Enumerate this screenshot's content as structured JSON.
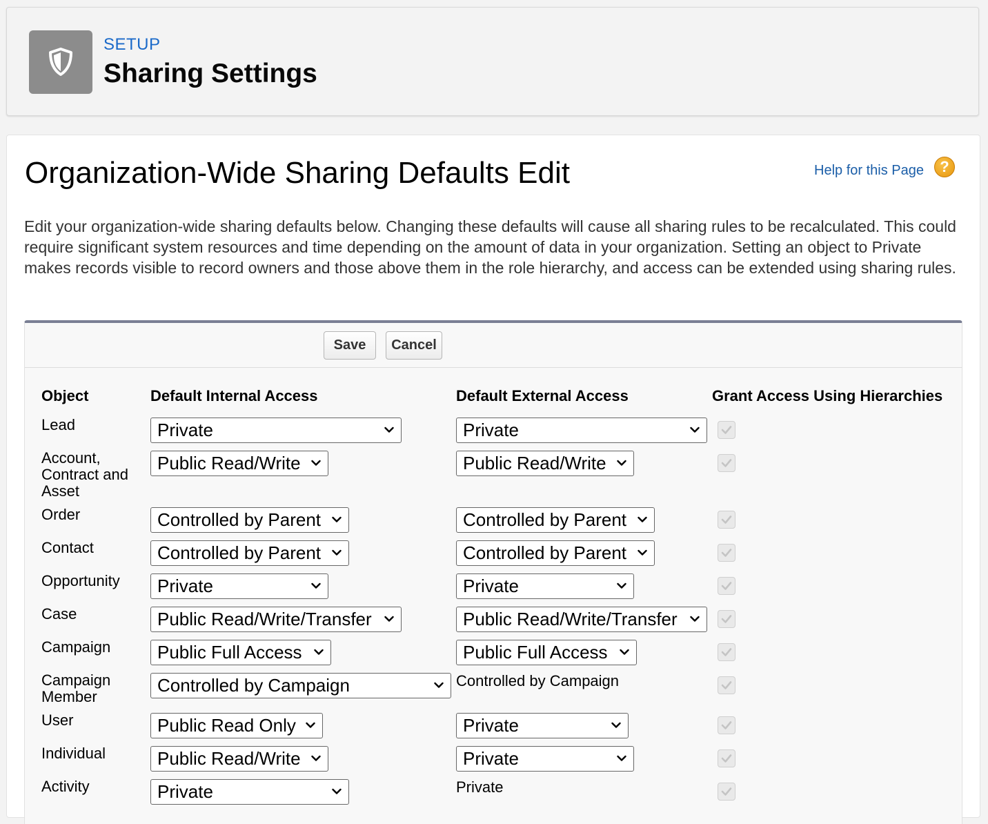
{
  "header": {
    "setup_label": "SETUP",
    "title": "Sharing Settings",
    "icon": "shield-icon"
  },
  "section": {
    "title": "Organization-Wide Sharing Defaults Edit",
    "help_link": "Help for this Page",
    "help_icon": "?",
    "description": "Edit your organization-wide sharing defaults below. Changing these defaults will cause all sharing rules to be recalculated. This could require significant system resources and time depending on the amount of data in your organization. Setting an object to Private makes records visible to record owners and those above them in the role hierarchy, and access can be extended using sharing rules."
  },
  "buttons": {
    "save": "Save",
    "cancel": "Cancel"
  },
  "columns": {
    "object": "Object",
    "internal": "Default Internal Access",
    "external": "Default External Access",
    "hierarchies": "Grant Access Using Hierarchies"
  },
  "rows": [
    {
      "object": "Lead",
      "internal": "Private",
      "external": "Private",
      "external_editable": true,
      "hierarchies": true
    },
    {
      "object": "Account,\nContract and\nAsset",
      "internal": "Public Read/Write",
      "external": "Public Read/Write",
      "external_editable": true,
      "hierarchies": true
    },
    {
      "object": "Order",
      "internal": "Controlled by Parent",
      "external": "Controlled by Parent",
      "external_editable": true,
      "hierarchies": true
    },
    {
      "object": "Contact",
      "internal": "Controlled by Parent",
      "external": "Controlled by Parent",
      "external_editable": true,
      "hierarchies": true
    },
    {
      "object": "Opportunity",
      "internal": "Private",
      "external": "Private",
      "external_editable": true,
      "hierarchies": true
    },
    {
      "object": "Case",
      "internal": "Public Read/Write/Transfer",
      "external": "Public Read/Write/Transfer",
      "external_editable": true,
      "hierarchies": true
    },
    {
      "object": "Campaign",
      "internal": "Public Full Access",
      "external": "Public Full Access",
      "external_editable": true,
      "hierarchies": true
    },
    {
      "object": "Campaign\nMember",
      "internal": "Controlled by Campaign",
      "external": "Controlled by Campaign",
      "external_editable": false,
      "hierarchies": true
    },
    {
      "object": "User",
      "internal": "Public Read Only",
      "external": "Private",
      "external_editable": true,
      "hierarchies": true
    },
    {
      "object": "Individual",
      "internal": "Public Read/Write",
      "external": "Private",
      "external_editable": true,
      "hierarchies": true
    },
    {
      "object": "Activity",
      "internal": "Private",
      "external": "Private",
      "external_editable": false,
      "hierarchies": true
    }
  ],
  "colors": {
    "link": "#1b5ea8",
    "setup_label": "#1b6ac9",
    "icon_bg": "#8c8c8c",
    "edit_top_border": "#7a7f94",
    "help_icon": "#e8960c"
  }
}
